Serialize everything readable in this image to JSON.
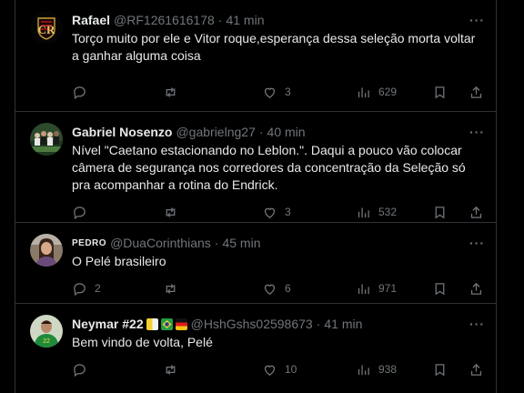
{
  "tweets": [
    {
      "name": "Rafael",
      "handle": "@RF1261616178",
      "separator": "·",
      "time": "41 min",
      "text": "Torço muito por ele e Vitor roque,esperança dessa seleção morta voltar a ganhar alguma coisa",
      "replies": "",
      "retweets": "",
      "likes": "3",
      "views": "629",
      "avatar_icon": "flamengo-crest-icon"
    },
    {
      "name": "Gabriel Nosenzo",
      "handle": "@gabrielng27",
      "separator": "·",
      "time": "40 min",
      "text": "Nível \"Caetano estacionando no Leblon.\". Daqui a pouco vão colocar câmera de segurança nos corredores da concentração da Seleção só pra acompanhar a rotina do Endrick.",
      "replies": "",
      "retweets": "",
      "likes": "3",
      "views": "532",
      "avatar_icon": "team-photo-avatar"
    },
    {
      "name": "PEDRO",
      "handle": "@DuaCorinthians",
      "separator": "·",
      "time": "45 min",
      "text": "O Pelé brasileiro",
      "replies": "2",
      "retweets": "",
      "likes": "6",
      "views": "971",
      "avatar_icon": "person-avatar"
    },
    {
      "name": "Neymar #22",
      "handle": "@HshGshs02598673",
      "separator": "·",
      "time": "41 min",
      "text": "Bem vindo de volta, Pelé",
      "replies": "",
      "retweets": "",
      "likes": "10",
      "views": "938",
      "avatar_icon": "player-avatar"
    }
  ],
  "more_label": "···",
  "colors": {
    "background": "#000000",
    "text": "#e7e9ea",
    "muted": "#71767b",
    "border": "#2f3336"
  }
}
